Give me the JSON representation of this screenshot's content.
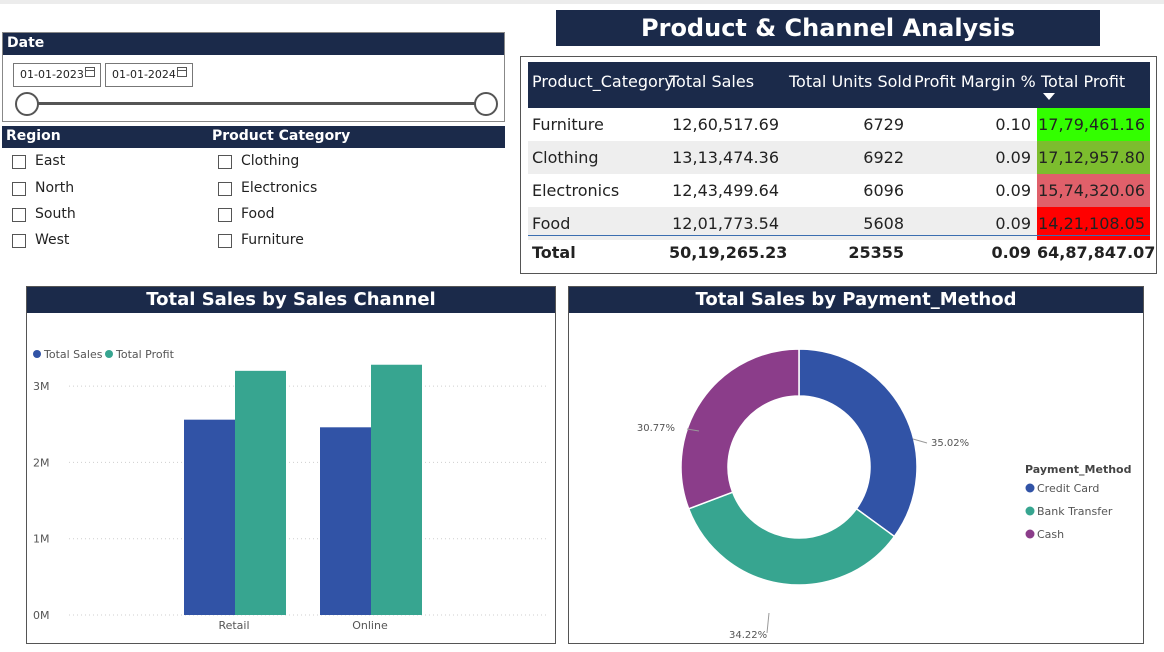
{
  "title": "Product & Channel Analysis",
  "date_slicer": {
    "header": "Date",
    "start_date": "01-01-2023",
    "end_date": "01-01-2024"
  },
  "region_slicer": {
    "header": "Region",
    "items": [
      "East",
      "North",
      "South",
      "West"
    ]
  },
  "category_slicer": {
    "header": "Product Category",
    "items": [
      "Clothing",
      "Electronics",
      "Food",
      "Furniture"
    ]
  },
  "table": {
    "columns": [
      "Product_Category",
      "Total Sales",
      "Total Units Sold",
      "Profit Margin %",
      "Total Profit"
    ],
    "sorted_column": "Total Profit",
    "rows": [
      {
        "category": "Furniture",
        "sales": "12,60,517.69",
        "units": "6729",
        "margin": "0.10",
        "profit": "17,79,461.16",
        "profit_color": "#33ff00"
      },
      {
        "category": "Clothing",
        "sales": "13,13,474.36",
        "units": "6922",
        "margin": "0.09",
        "profit": "17,12,957.80",
        "profit_color": "#7cbd2e"
      },
      {
        "category": "Electronics",
        "sales": "12,43,499.64",
        "units": "6096",
        "margin": "0.09",
        "profit": "15,74,320.06",
        "profit_color": "#e0606a"
      },
      {
        "category": "Food",
        "sales": "12,01,773.54",
        "units": "5608",
        "margin": "0.09",
        "profit": "14,21,108.05",
        "profit_color": "#ff0000"
      }
    ],
    "total": {
      "label": "Total",
      "sales": "50,19,265.23",
      "units": "25355",
      "margin": "0.09",
      "profit": "64,87,847.07"
    }
  },
  "chart_data": [
    {
      "type": "bar",
      "title": "Total Sales by Sales Channel",
      "categories": [
        "Retail",
        "Online"
      ],
      "series": [
        {
          "name": "Total Sales",
          "values": [
            2560000,
            2460000
          ],
          "color": "#3153a6"
        },
        {
          "name": "Total Profit",
          "values": [
            3200000,
            3280000
          ],
          "color": "#37a590"
        }
      ],
      "yticks": [
        "0M",
        "1M",
        "2M",
        "3M"
      ],
      "ylim": [
        0,
        3000000
      ],
      "legend": "top-left",
      "grid": true
    },
    {
      "type": "pie",
      "title": "Total Sales by Payment_Method",
      "donut": true,
      "legend_title": "Payment_Method",
      "legend": "right",
      "slices": [
        {
          "name": "Credit Card",
          "value": 35.02,
          "label": "35.02%",
          "color": "#3153a6"
        },
        {
          "name": "Bank Transfer",
          "value": 34.22,
          "label": "34.22%",
          "color": "#37a590"
        },
        {
          "name": "Cash",
          "value": 30.77,
          "label": "30.77%",
          "color": "#8b3d8a"
        }
      ]
    }
  ],
  "colors": {
    "header_navy": "#1b2a4a",
    "row_alt": "#eeeeee"
  }
}
